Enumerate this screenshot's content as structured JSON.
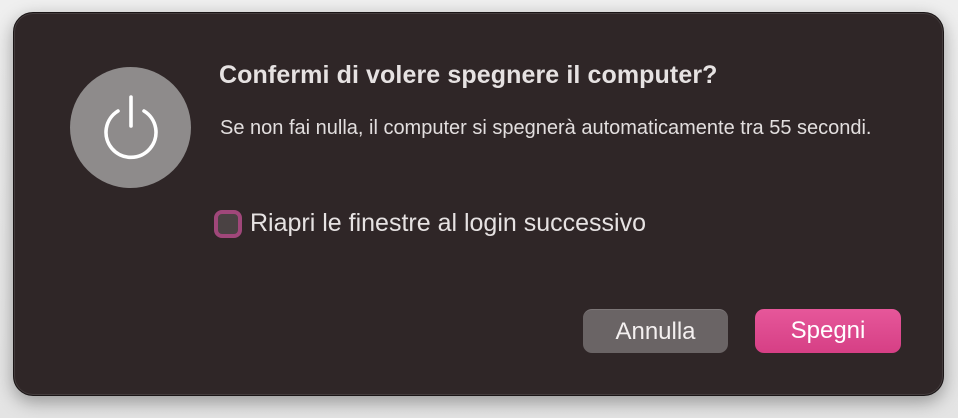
{
  "dialog": {
    "title": "Confermi di volere spegnere il computer?",
    "message": "Se non fai nulla, il computer si spegnerà automaticamente tra 55 secondi.",
    "icon": "power-icon",
    "checkbox": {
      "label": "Riapri le finestre al login successivo",
      "checked": false
    },
    "buttons": {
      "cancel_label": "Annulla",
      "confirm_label": "Spegni"
    }
  },
  "colors": {
    "dialog_background": "#2f2627",
    "accent": "#e04d91",
    "icon_badge": "#8e8b8b",
    "secondary_button": "#6a6465"
  }
}
